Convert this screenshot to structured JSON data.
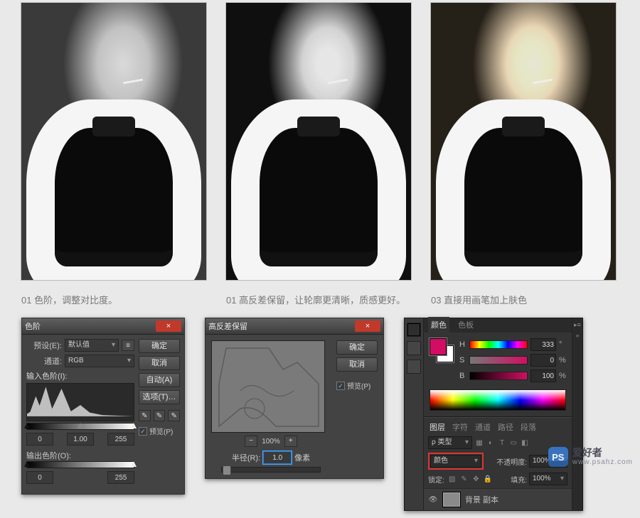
{
  "captions": [
    "01 色阶，调整对比度。",
    "01 高反差保留，让轮廓更清晰，质感更好。",
    "03 直接用画笔加上肤色"
  ],
  "levels": {
    "title": "色阶",
    "preset_label": "预设(E):",
    "preset_value": "默认值",
    "channel_label": "通道:",
    "channel_value": "RGB",
    "input_label": "输入色阶(I):",
    "in_black": "0",
    "in_gamma": "1.00",
    "in_white": "255",
    "output_label": "输出色阶(O):",
    "out_black": "0",
    "out_white": "255",
    "btn_ok": "确定",
    "btn_cancel": "取消",
    "btn_auto": "自动(A)",
    "btn_options": "选项(T)…",
    "preview": "预览(P)"
  },
  "highpass": {
    "title": "高反差保留",
    "btn_ok": "确定",
    "btn_cancel": "取消",
    "preview": "预览(P)",
    "zoom": "100%",
    "radius_label": "半径(R):",
    "radius_value": "1.0",
    "radius_unit": "像素"
  },
  "ps": {
    "tabs_color": [
      "颜色",
      "色板"
    ],
    "H_label": "H",
    "S_label": "S",
    "B_label": "B",
    "H": "333",
    "S": "0",
    "B": "100",
    "deg": "°",
    "pct": "%",
    "tabs_layers": [
      "图层",
      "字符",
      "通道",
      "路径",
      "段落"
    ],
    "type_label": "ρ 类型",
    "blend_mode": "颜色",
    "opacity_label": "不透明度:",
    "opacity": "100%",
    "lock_label": "锁定:",
    "fill_label": "填充:",
    "fill": "100%",
    "layer_name": "背景 副本"
  },
  "watermark": {
    "logo": "PS",
    "cn": "爱好者",
    "en": "www.psahz.com"
  }
}
